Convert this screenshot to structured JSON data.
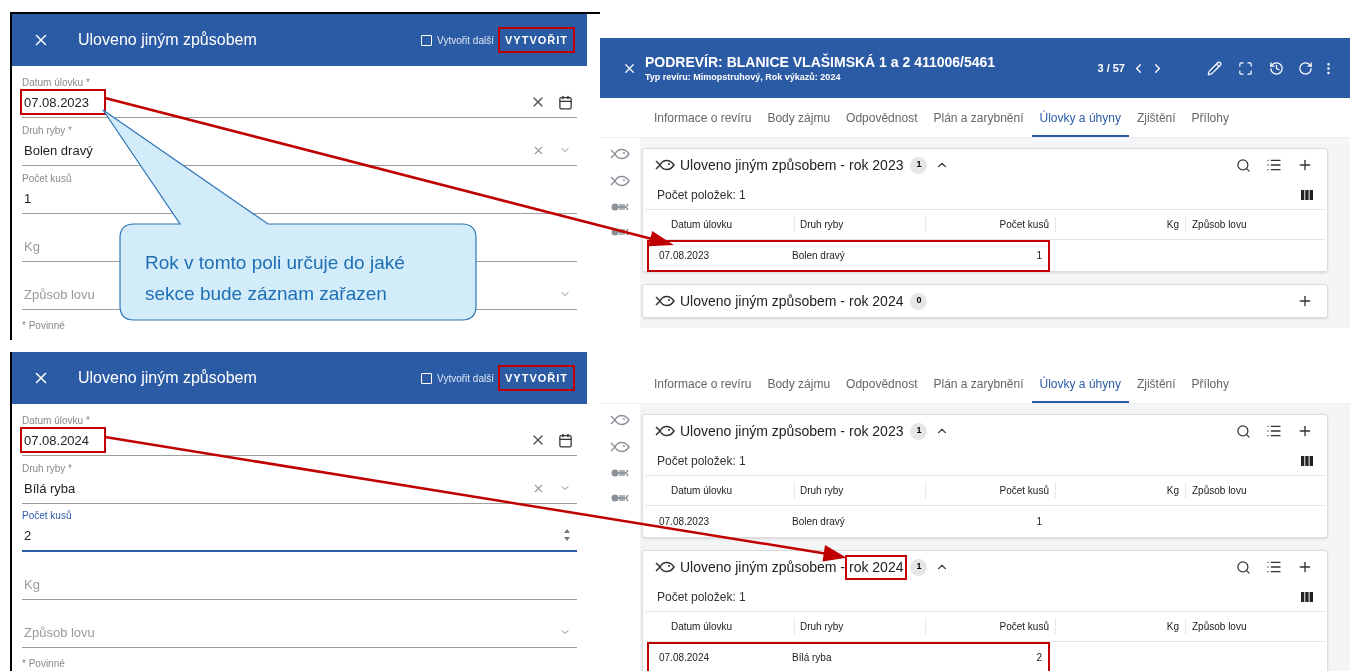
{
  "forms": [
    {
      "title": "Uloveno jiným způsobem",
      "create_another": {
        "label": "Vytvořit další",
        "checked": false
      },
      "create_button": {
        "label": "VYTVOŘIT",
        "highlighted": true
      },
      "fields": [
        {
          "kind": "date",
          "label": "Datum úlovku *",
          "value": "07.08.2023",
          "focused": false,
          "highlighted": true
        },
        {
          "kind": "select",
          "label": "Druh ryby *",
          "value": "Bolen dravý",
          "focused": false,
          "highlighted": false
        },
        {
          "kind": "number",
          "label": "Počet kusů",
          "value": "1",
          "focused": false,
          "highlighted": false
        },
        {
          "kind": "number",
          "placeholder": "Kg",
          "focused": false,
          "highlighted": false
        },
        {
          "kind": "select",
          "placeholder": "Způsob lovu",
          "focused": false,
          "highlighted": false
        }
      ],
      "required_note": "* Povinné"
    },
    {
      "title": "Uloveno jiným způsobem",
      "create_another": {
        "label": "Vytvořit další",
        "checked": false
      },
      "create_button": {
        "label": "VYTVOŘIT",
        "highlighted": true
      },
      "fields": [
        {
          "kind": "date",
          "label": "Datum úlovku *",
          "value": "07.08.2024",
          "focused": false,
          "highlighted": true
        },
        {
          "kind": "select",
          "label": "Druh ryby *",
          "value": "Bílá ryba",
          "focused": false,
          "highlighted": false
        },
        {
          "kind": "number",
          "label": "Počet kusů",
          "value": "2",
          "focused": true,
          "highlighted": false
        },
        {
          "kind": "number",
          "placeholder": "Kg",
          "focused": false,
          "highlighted": false
        },
        {
          "kind": "select",
          "placeholder": "Způsob lovu",
          "focused": false,
          "highlighted": false
        }
      ],
      "required_note": "* Povinné"
    }
  ],
  "callout": "Rok v tomto poli určuje do jaké sekce bude záznam zařazen",
  "record_views": [
    {
      "header": {
        "title": "PODREVÍR: BLANICE VLAŠIMSKÁ 1 a 2 411006/5461",
        "subtitle": "Typ revíru: Mimopstruhový, Rok výkazů: 2024",
        "pager": "3 / 57"
      },
      "tabs": [
        {
          "label": "Informace o revíru",
          "selected": false
        },
        {
          "label": "Body zájmu",
          "selected": false
        },
        {
          "label": "Odpovědnost",
          "selected": false
        },
        {
          "label": "Plán a zarybnění",
          "selected": false
        },
        {
          "label": "Úlovky a úhyny",
          "selected": true
        },
        {
          "label": "Zjištění",
          "selected": false
        },
        {
          "label": "Přílohy",
          "selected": false
        }
      ],
      "sections": [
        {
          "title": "Uloveno jiným způsobem -",
          "year": "rok 2023",
          "year_highlighted": false,
          "count": "1",
          "expanded": true,
          "items_count": "Počet položek: 1",
          "columns": [
            "Datum úlovku",
            "Druh ryby",
            "Počet kusů",
            "Kg",
            "Způsob lovu"
          ],
          "rows": [
            {
              "cells": [
                "07.08.2023",
                "Bolen dravý",
                "1"
              ],
              "highlighted": true
            }
          ]
        },
        {
          "title": "Uloveno jiným způsobem -",
          "year": "rok 2024",
          "year_highlighted": false,
          "count": "0",
          "expanded": false
        }
      ]
    },
    {
      "tabs": [
        {
          "label": "Informace o revíru",
          "selected": false
        },
        {
          "label": "Body zájmu",
          "selected": false
        },
        {
          "label": "Odpovědnost",
          "selected": false
        },
        {
          "label": "Plán a zarybnění",
          "selected": false
        },
        {
          "label": "Úlovky a úhyny",
          "selected": true
        },
        {
          "label": "Zjištění",
          "selected": false
        },
        {
          "label": "Přílohy",
          "selected": false
        }
      ],
      "sections": [
        {
          "title": "Uloveno jiným způsobem -",
          "year": "rok 2023",
          "year_highlighted": false,
          "count": "1",
          "expanded": true,
          "items_count": "Počet položek: 1",
          "columns": [
            "Datum úlovku",
            "Druh ryby",
            "Počet kusů",
            "Kg",
            "Způsob lovu"
          ],
          "rows": [
            {
              "cells": [
                "07.08.2023",
                "Bolen dravý",
                "1"
              ],
              "highlighted": false
            }
          ]
        },
        {
          "title": "Uloveno jiným způsobem -",
          "year": "rok 2024",
          "year_highlighted": true,
          "count": "1",
          "expanded": true,
          "items_count": "Počet položek: 1",
          "columns": [
            "Datum úlovku",
            "Druh ryby",
            "Počet kusů",
            "Kg",
            "Způsob lovu"
          ],
          "rows": [
            {
              "cells": [
                "07.08.2024",
                "Bílá ryba",
                "2"
              ],
              "highlighted": true
            }
          ]
        }
      ]
    }
  ]
}
